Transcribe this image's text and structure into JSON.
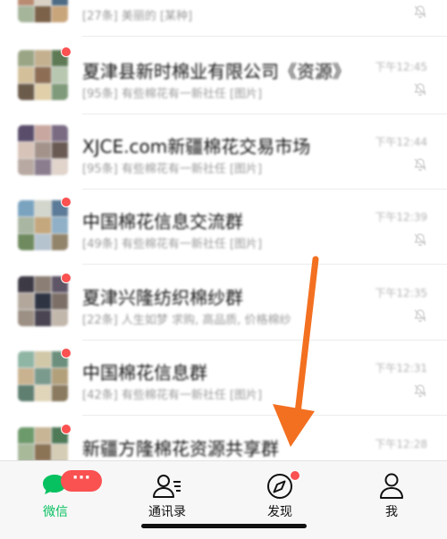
{
  "chats": [
    {
      "title": "",
      "preview": "[27条] 美丽的 [某种]",
      "time": "",
      "muted": true,
      "unread_dot": false
    },
    {
      "title": "夏津县新时棉业有限公司《资源》",
      "preview": "[95条] 有些棉花有一新社任 [图片]",
      "time": "下午12:45",
      "muted": true,
      "unread_dot": true
    },
    {
      "title": "XJCE.com新疆棉花交易市场",
      "preview": "[95条] 有些棉花有一新社任 [图片]",
      "time": "下午12:44",
      "muted": true,
      "unread_dot": false
    },
    {
      "title": "中国棉花信息交流群",
      "preview": "[49条] 有些棉花有一新社任 [图片]",
      "time": "下午12:39",
      "muted": true,
      "unread_dot": true
    },
    {
      "title": "夏津兴隆纺织棉纱群",
      "preview": "[22条] 人生如梦 求购, 高品质, 价格棉纱",
      "time": "下午12:35",
      "muted": true,
      "unread_dot": true
    },
    {
      "title": "中国棉花信息群",
      "preview": "[42条] 有些棉花有一新社任 [图片]",
      "time": "下午12:31",
      "muted": true,
      "unread_dot": true
    },
    {
      "title": "新疆方隆棉花资源共享群",
      "preview": "",
      "time": "下午12:28",
      "muted": false,
      "unread_dot": true
    }
  ],
  "tabs": {
    "weixin": {
      "label": "微信",
      "badge": "···"
    },
    "contacts": {
      "label": "通讯录"
    },
    "discover": {
      "label": "发现"
    },
    "me": {
      "label": "我"
    }
  },
  "colors": {
    "accent": "#07c160",
    "badge": "#fa5151",
    "arrow": "#f37021"
  },
  "icons": [
    "chat-bubble-icon",
    "contacts-icon",
    "compass-icon",
    "person-icon",
    "mute-bell-icon"
  ]
}
